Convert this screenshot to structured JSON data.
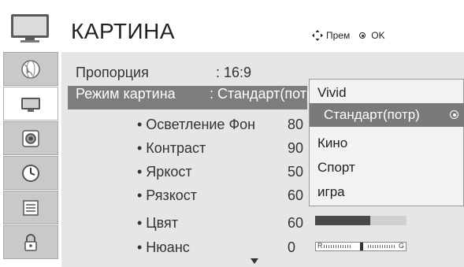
{
  "header": {
    "title": "КАРТИНА",
    "nav_hint_move": "Прем",
    "nav_hint_ok": "OK"
  },
  "sidebar": {
    "items": [
      {
        "icon": "globe-icon",
        "active": false
      },
      {
        "icon": "tv-icon",
        "active": true
      },
      {
        "icon": "speaker-icon",
        "active": false
      },
      {
        "icon": "clock-icon",
        "active": false
      },
      {
        "icon": "list-icon",
        "active": false
      },
      {
        "icon": "lock-icon",
        "active": false
      }
    ]
  },
  "picture_menu": {
    "rows": [
      {
        "label": "Пропорция",
        "value": ": 16:9"
      },
      {
        "label": "Режим картина",
        "value": ": Стандарт(потр"
      },
      {
        "label": "• Осветление Фон",
        "value": "80",
        "bar_fill": 0.8
      },
      {
        "label": "• Контраст",
        "value": "90",
        "bar_fill": 0.9
      },
      {
        "label": "• Яркост",
        "value": "50",
        "bar_fill": 0.5
      },
      {
        "label": "• Рязкост",
        "value": "60",
        "bar_fill": 0.6
      },
      {
        "label": "• Цвят",
        "value": "60",
        "bar_fill": 0.6
      },
      {
        "label": "• Нюанс",
        "value": "0",
        "tint_left": "R",
        "tint_right": "G"
      }
    ]
  },
  "dropdown": {
    "options": [
      "Vivid",
      "Стандарт(потр)",
      "Кино",
      "Спорт",
      "игра"
    ],
    "selected_index": 1
  },
  "colors": {
    "panel_bg": "#e6e6e6",
    "selected_row": "#7d7d7d",
    "bar_fill": "#4a4a4a"
  }
}
